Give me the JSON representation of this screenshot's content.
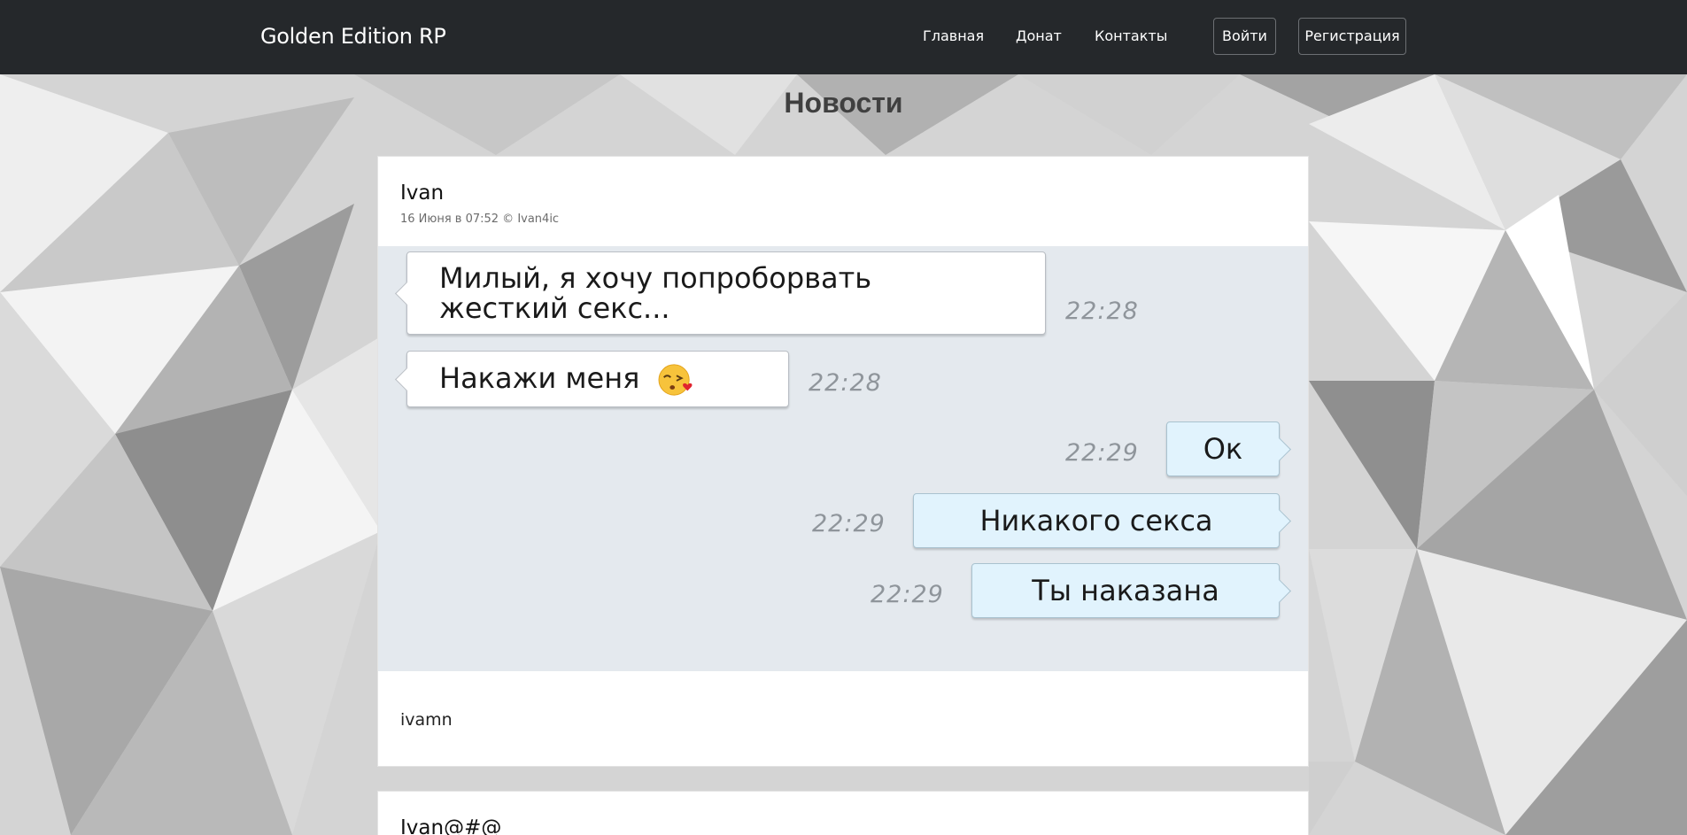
{
  "navbar": {
    "brand": "Golden Edition RP",
    "links": [
      "Главная",
      "Донат",
      "Контакты"
    ],
    "login_label": "Войти",
    "register_label": "Регистрация"
  },
  "page": {
    "title": "Новости"
  },
  "posts": [
    {
      "title": "Ivan",
      "meta": "16 Июня в 07:52 © Ivan4ic",
      "chat": [
        {
          "side": "in",
          "text": "Милый, я хочу попроборвать\nжесткий секс...",
          "time": "22:28"
        },
        {
          "side": "in",
          "text": "Накажи меня",
          "time": "22:28",
          "icon": "kissing-face-emoji-icon"
        },
        {
          "side": "out",
          "text": "Ок",
          "time": "22:29"
        },
        {
          "side": "out",
          "text": "Никакого секса",
          "time": "22:29"
        },
        {
          "side": "out",
          "text": "Ты наказана",
          "time": "22:29"
        }
      ],
      "body": "ivamn"
    },
    {
      "title": "Ivan@#@"
    }
  ],
  "colors": {
    "navbar_bg": "#25282b",
    "chat_bg": "#e4e9ee",
    "outgoing_bubble": "#e1f3fd",
    "incoming_bubble": "#ffffff"
  }
}
